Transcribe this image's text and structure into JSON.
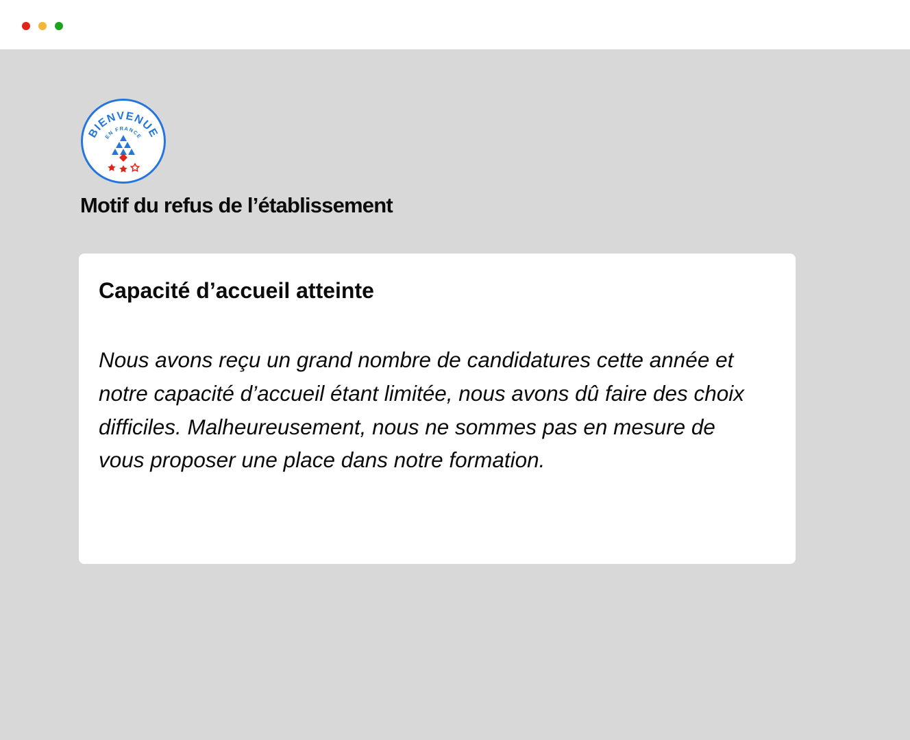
{
  "colors": {
    "window_close": "#e0251b",
    "window_minimize": "#f4b63a",
    "window_maximize": "#1ea31e",
    "page_background": "#d8d8d8",
    "card_background": "#ffffff",
    "logo_blue": "#2576dc",
    "logo_red": "#e2231a",
    "text": "#0b0b0b"
  },
  "logo": {
    "name": "Bienvenue en France",
    "main_text": "BIENVENUE",
    "sub_text": "EN FRANCE",
    "stars": 3
  },
  "page": {
    "title": "Motif du refus de l’établissement"
  },
  "refusal": {
    "title": "Capacité d’accueil atteinte",
    "message": "Nous avons reçu un grand nombre de candidatures cette année et notre capacité d’accueil étant limitée, nous avons dû faire des choix difficiles. Malheureusement, nous ne sommes pas en mesure de vous proposer une place dans notre formation."
  }
}
